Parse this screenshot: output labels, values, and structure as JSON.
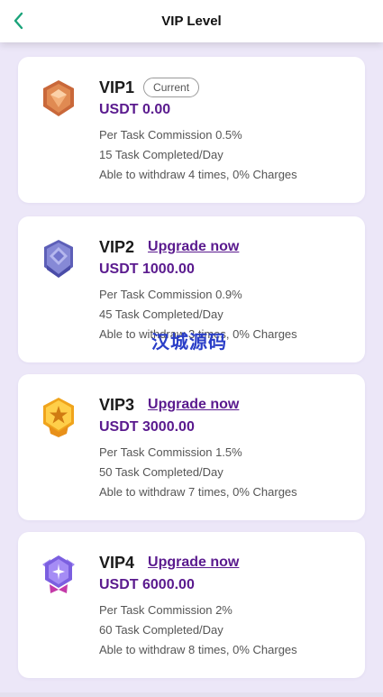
{
  "header": {
    "title": "VIP Level",
    "back_icon": "chevron-left-icon",
    "accent_color": "#1aa37a"
  },
  "colors": {
    "background": "#ece7f8",
    "price": "#5a1a8e",
    "link": "#5a1a8e"
  },
  "levels": [
    {
      "name": "VIP1",
      "status_label": "Current",
      "upgrade_label": "",
      "price": "USDT 0.00",
      "commission": "Per Task Commission 0.5%",
      "tasks": "15 Task Completed/Day",
      "withdraw": "Able to withdraw 4 times, 0% Charges",
      "badge_icon": "bronze-shield-badge-icon"
    },
    {
      "name": "VIP2",
      "status_label": "",
      "upgrade_label": "Upgrade now",
      "price": "USDT 1000.00",
      "commission": "Per Task Commission 0.9%",
      "tasks": "45 Task Completed/Day",
      "withdraw": "Able to withdraw 3 times, 0% Charges",
      "badge_icon": "silver-shield-badge-icon"
    },
    {
      "name": "VIP3",
      "status_label": "",
      "upgrade_label": "Upgrade now",
      "price": "USDT 3000.00",
      "commission": "Per Task Commission 1.5%",
      "tasks": "50 Task Completed/Day",
      "withdraw": "Able to withdraw 7 times, 0% Charges",
      "badge_icon": "gold-star-badge-icon"
    },
    {
      "name": "VIP4",
      "status_label": "",
      "upgrade_label": "Upgrade now",
      "price": "USDT 6000.00",
      "commission": "Per Task Commission 2%",
      "tasks": "60 Task Completed/Day",
      "withdraw": "Able to withdraw 8 times, 0% Charges",
      "badge_icon": "purple-crystal-badge-icon"
    }
  ],
  "watermark": "汉城源码"
}
